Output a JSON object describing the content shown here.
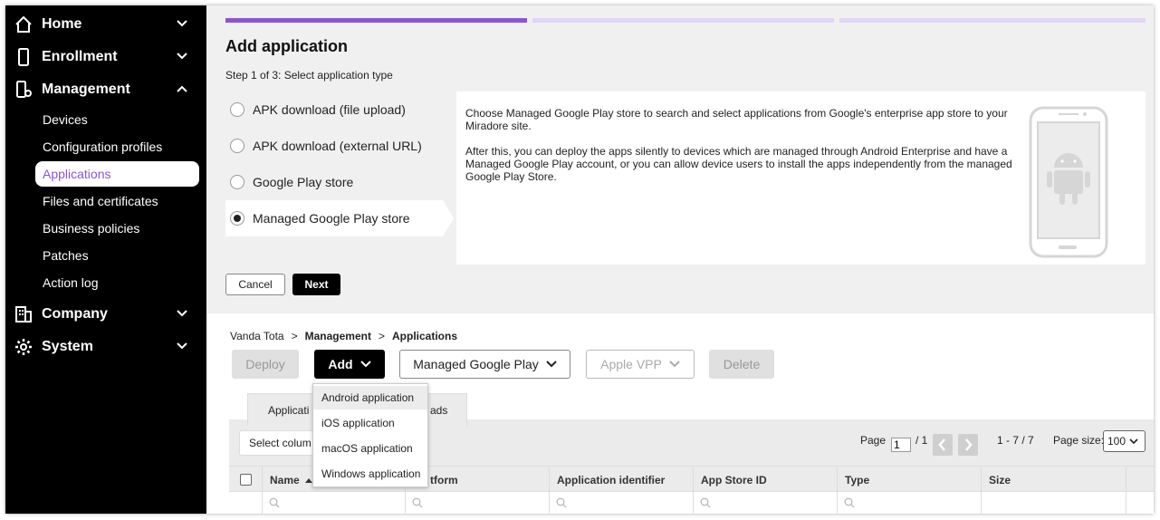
{
  "sidebar": {
    "items": [
      {
        "label": "Home",
        "icon": "home-icon"
      },
      {
        "label": "Enrollment",
        "icon": "mobile-icon"
      },
      {
        "label": "Management",
        "icon": "management-icon"
      },
      {
        "label": "Company",
        "icon": "building-icon"
      },
      {
        "label": "System",
        "icon": "gear-icon"
      }
    ],
    "management_children": [
      {
        "label": "Devices"
      },
      {
        "label": "Configuration profiles"
      },
      {
        "label": "Applications",
        "active": true
      },
      {
        "label": "Files and certificates"
      },
      {
        "label": "Business policies"
      },
      {
        "label": "Patches"
      },
      {
        "label": "Action log"
      }
    ]
  },
  "wizard": {
    "title": "Add application",
    "step_text": "Step 1 of 3: Select application type",
    "current_step": 1,
    "total_steps": 3,
    "options": [
      {
        "label": "APK download (file upload)",
        "selected": false
      },
      {
        "label": "APK download (external URL)",
        "selected": false
      },
      {
        "label": "Google Play store",
        "selected": false
      },
      {
        "label": "Managed Google Play store",
        "selected": true
      }
    ],
    "description_p1": "Choose Managed Google Play store to search and select applications from Google's enterprise app store to your Miradore site.",
    "description_p2": "After this, you can deploy the apps silently to devices which are managed through Android Enterprise and have a Managed Google Play account, or you can allow device users to install the apps independently from the managed Google Play Store.",
    "illustration": "android-phone-icon",
    "cancel_label": "Cancel",
    "next_label": "Next"
  },
  "breadcrumb": {
    "user": "Vanda Tota",
    "separator": ">",
    "section": "Management",
    "page": "Applications"
  },
  "toolbar": {
    "deploy_label": "Deploy",
    "add_label": "Add",
    "managed_google_play_label": "Managed Google Play",
    "apple_vpp_label": "Apple VPP",
    "delete_label": "Delete"
  },
  "add_menu": {
    "items": [
      "Android application",
      "iOS application",
      "macOS application",
      "Windows application"
    ]
  },
  "tabs": {
    "applications_label": "Applicati",
    "downloads_label": "ads"
  },
  "grid": {
    "select_columns_label": "Select colum",
    "page_label": "Page",
    "page_value": "1",
    "page_total": "/ 1",
    "range_text": "1 - 7 / 7",
    "page_size_label": "Page size:",
    "page_size_value": "100",
    "columns": [
      "Name",
      "tform",
      "Application identifier",
      "App Store ID",
      "Type",
      "Size"
    ]
  },
  "colors": {
    "accent": "#8a55d6",
    "progress_inactive": "#e2d5f5",
    "sidebar_bg": "#000000"
  }
}
